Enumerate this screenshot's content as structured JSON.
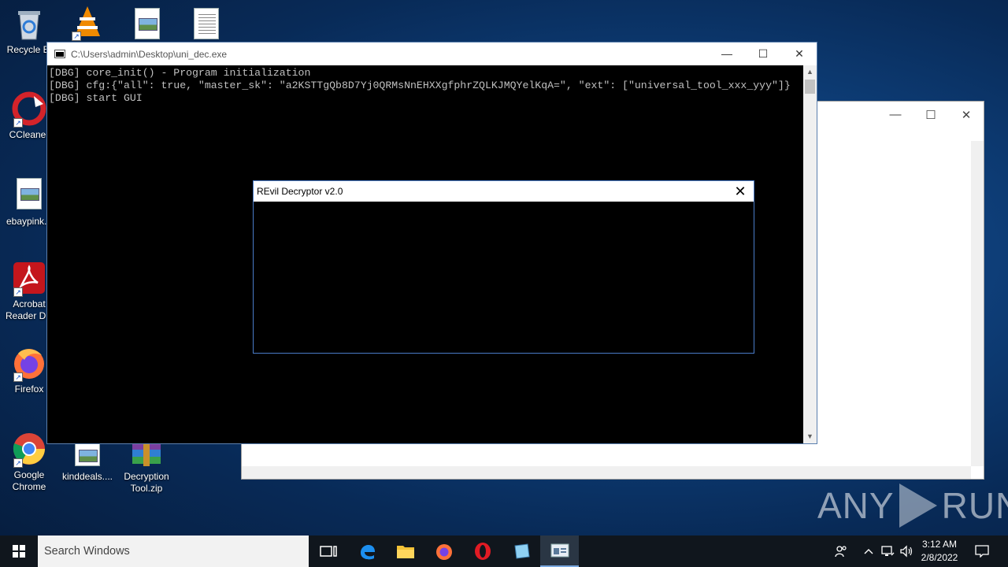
{
  "desktop": {
    "icons": [
      {
        "label": "Recycle Bi",
        "icon": "recycle-bin-icon"
      },
      {
        "label": "CCleaner",
        "icon": "ccleaner-icon"
      },
      {
        "label": "ebaypink...",
        "icon": "image-file-icon"
      },
      {
        "label": "Acrobat Reader DC",
        "label_line1": "Acrobat",
        "label_line2": "Reader DC",
        "icon": "acrobat-icon"
      },
      {
        "label": "Firefox",
        "icon": "firefox-icon"
      },
      {
        "label": "Google Chrome",
        "label_line1": "Google",
        "label_line2": "Chrome",
        "icon": "chrome-icon"
      },
      {
        "label": "kinddeals....",
        "icon": "image-file-icon"
      },
      {
        "label": "Decryption Tool.zip",
        "label_line1": "Decryption",
        "label_line2": "Tool.zip",
        "icon": "winrar-archive-icon"
      }
    ],
    "top_icons": [
      "vlc-icon",
      "image-file-icon",
      "text-file-icon"
    ]
  },
  "console": {
    "title": "C:\\Users\\admin\\Desktop\\uni_dec.exe",
    "lines": [
      "[DBG] core_init() - Program initialization",
      "[DBG] cfg:{\"all\": true, \"master_sk\": \"a2KSTTgQb8D7Yj0QRMsNnEHXXgfphrZQLKJMQYelKqA=\", \"ext\": [\"universal_tool_xxx_yyy\"]}",
      "[DBG] start GUI"
    ]
  },
  "dialog": {
    "title": "REvil Decryptor v2.0"
  },
  "taskbar": {
    "search_placeholder": "Search Windows",
    "apps": [
      "task-view-icon",
      "edge-icon",
      "file-explorer-icon",
      "firefox-icon",
      "opera-icon",
      "notepad-icon",
      "console-app-icon"
    ],
    "time": "3:12 AM",
    "date": "2/8/2022"
  },
  "watermark": {
    "left": "ANY",
    "right": "RUN"
  },
  "colors": {
    "console_text": "#c0c0c0",
    "dialog_border": "#4a7cc9",
    "taskbar_bg": "#10161d"
  }
}
